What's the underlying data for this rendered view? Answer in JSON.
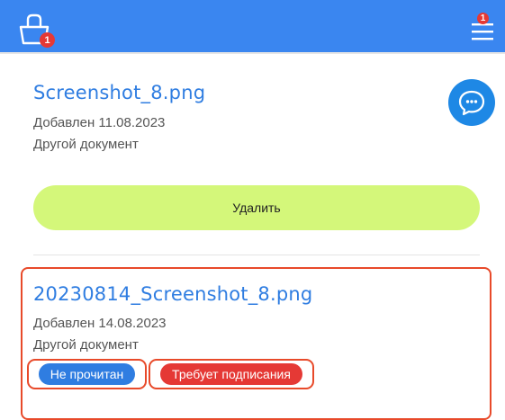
{
  "header": {
    "cart_badge": "1",
    "menu_badge": "1",
    "cart_icon": "shopping-bag-icon",
    "menu_icon": "hamburger-menu-icon",
    "bar_color": "#3a86f0"
  },
  "documents": [
    {
      "title": "Screenshot_8.png",
      "added": "Добавлен 11.08.2023",
      "type": "Другой документ",
      "delete_label": "Удалить"
    },
    {
      "title": "20230814_Screenshot_8.png",
      "added": "Добавлен 14.08.2023",
      "type": "Другой документ",
      "status_read": "Не прочитан",
      "status_sign": "Требует подписания"
    }
  ],
  "chat": {
    "icon": "chat-bubble-icon",
    "color": "#1e88e5"
  },
  "colors": {
    "accent": "#2f7de1",
    "delete": "#d4f77a",
    "alert": "#e53935",
    "highlight": "#e84a2a"
  }
}
